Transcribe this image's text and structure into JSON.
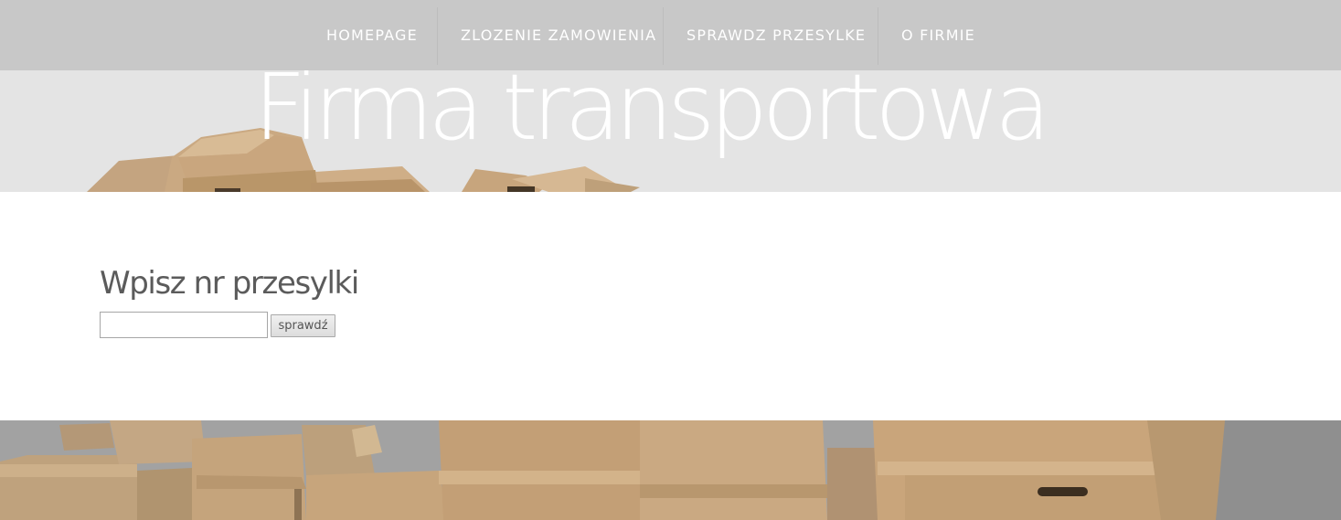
{
  "nav": {
    "items": [
      {
        "label": "HOMEPAGE"
      },
      {
        "label": "ZLOZENIE ZAMOWIENIA"
      },
      {
        "label": "SPRAWDZ PRZESYLKE"
      },
      {
        "label": "O FIRMIE"
      }
    ]
  },
  "hero": {
    "title": "Firma transportowa",
    "image": "cardboard-boxes-photo"
  },
  "tracking_form": {
    "heading": "Wpisz nr przesylki",
    "input_value": "",
    "input_placeholder": "",
    "button_label": "sprawdź"
  },
  "footer": {
    "image": "cardboard-boxes-photo"
  },
  "colors": {
    "nav_background": "#c8c8c8",
    "hero_background": "#e4e4e4",
    "text_heading": "#5b5b5b",
    "cardboard": "#c9a981"
  }
}
